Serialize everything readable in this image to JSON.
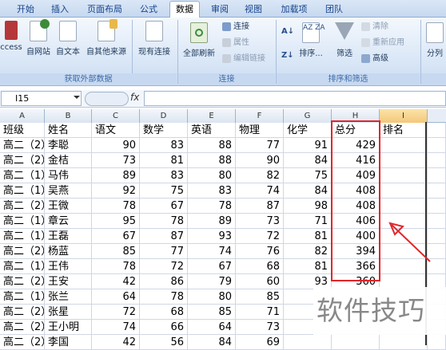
{
  "tabs": [
    "开始",
    "插入",
    "页面布局",
    "公式",
    "数据",
    "审阅",
    "视图",
    "加载项",
    "团队"
  ],
  "active_tab": "数据",
  "ribbon": {
    "groups": [
      "获取外部数据",
      "连接",
      "排序和筛选"
    ],
    "access": "ccess",
    "web": "自网站",
    "text": "自文本",
    "other": "自其他来源",
    "existing": "现有连接",
    "refresh": "全部刷新",
    "connections": "连接",
    "properties": "属性",
    "edit_links": "编辑链接",
    "sort": "排序...",
    "filter": "筛选",
    "clear": "清除",
    "reapply": "重新应用",
    "advanced": "高级",
    "split": "分列"
  },
  "formula_bar": {
    "cell_ref": "I15",
    "fx": "fx",
    "formula": ""
  },
  "columns": [
    "A",
    "B",
    "C",
    "D",
    "E",
    "F",
    "G",
    "H",
    "I"
  ],
  "headers": [
    "班级",
    "姓名",
    "语文",
    "数学",
    "英语",
    "物理",
    "化学",
    "总分",
    "排名"
  ],
  "rows": [
    [
      "高二（2）",
      "李聪",
      "90",
      "83",
      "88",
      "77",
      "91",
      "429",
      ""
    ],
    [
      "高二（2）",
      "金桔",
      "73",
      "81",
      "88",
      "90",
      "84",
      "416",
      ""
    ],
    [
      "高二（1）",
      "马伟",
      "89",
      "83",
      "80",
      "82",
      "75",
      "409",
      ""
    ],
    [
      "高二（1）",
      "吴燕",
      "92",
      "75",
      "83",
      "74",
      "84",
      "408",
      ""
    ],
    [
      "高二（2）",
      "王微",
      "78",
      "67",
      "78",
      "87",
      "98",
      "408",
      ""
    ],
    [
      "高二（1）",
      "章云",
      "95",
      "78",
      "89",
      "73",
      "71",
      "406",
      ""
    ],
    [
      "高二（1）",
      "王磊",
      "67",
      "87",
      "93",
      "72",
      "81",
      "400",
      ""
    ],
    [
      "高二（2）",
      "杨蓝",
      "85",
      "77",
      "74",
      "76",
      "82",
      "394",
      ""
    ],
    [
      "高二（1）",
      "王伟",
      "78",
      "72",
      "67",
      "68",
      "81",
      "366",
      ""
    ],
    [
      "高二（2）",
      "王安",
      "42",
      "86",
      "79",
      "60",
      "93",
      "360",
      ""
    ],
    [
      "高二（1）",
      "张兰",
      "64",
      "78",
      "80",
      "85",
      "",
      "",
      " "
    ],
    [
      "高二（2）",
      "张星",
      "72",
      "68",
      "85",
      "71",
      "",
      "",
      ""
    ],
    [
      "高二（2）",
      "王小明",
      "74",
      "66",
      "64",
      "73",
      "",
      "",
      ""
    ],
    [
      "高二（2）",
      "李国",
      "42",
      "56",
      "84",
      "69",
      "",
      "",
      ""
    ]
  ],
  "watermark": "软件技巧"
}
